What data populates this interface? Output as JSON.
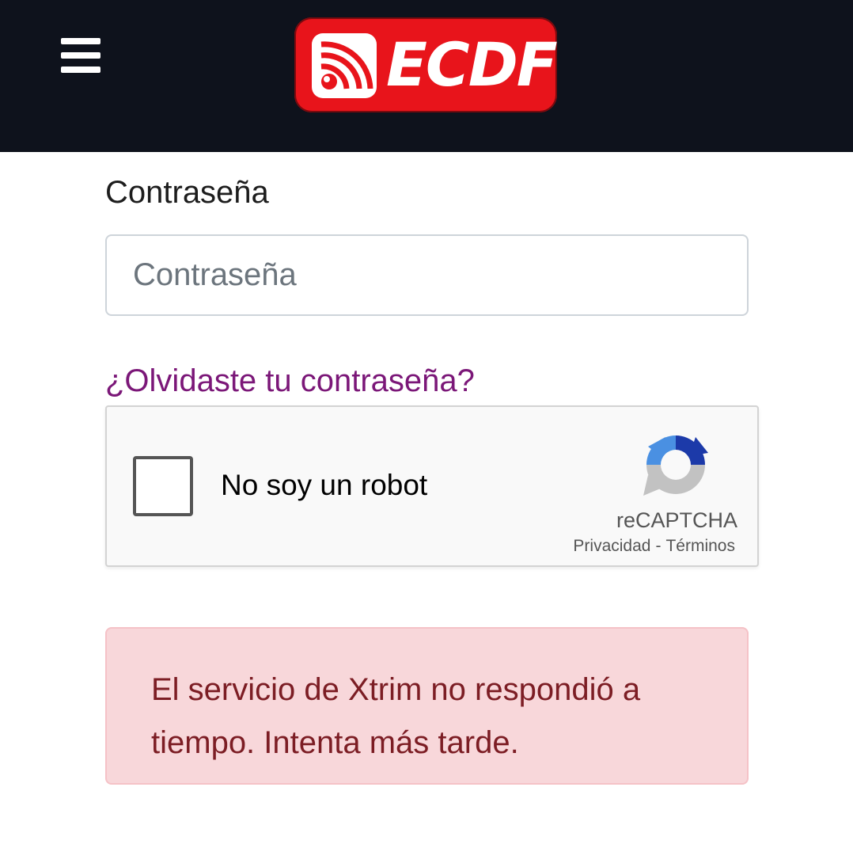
{
  "header": {
    "menu_icon": "hamburger-menu-icon",
    "logo_text": "ECDF",
    "logo_icon": "broadcast-signal-icon",
    "colors": {
      "background": "#0e121c",
      "logo_red": "#e8141b"
    }
  },
  "form": {
    "password_label": "Contraseña",
    "password_placeholder": "Contraseña",
    "password_value": "",
    "forgot_link": "¿Olvidaste tu contraseña?",
    "link_color": "#7b1778"
  },
  "recaptcha": {
    "checkbox_label": "No soy un robot",
    "checked": false,
    "brand": "reCAPTCHA",
    "privacy_link": "Privacidad",
    "separator": "-",
    "terms_link": "Términos",
    "logo_icon": "recaptcha-icon"
  },
  "alert": {
    "message": "El servicio de Xtrim no respondió a tiempo. Intenta más tarde.",
    "type": "danger",
    "colors": {
      "background": "#f8d7da",
      "text": "#7c1d24"
    }
  }
}
